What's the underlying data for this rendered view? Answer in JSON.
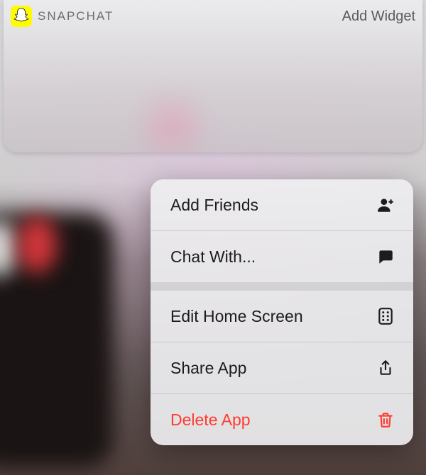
{
  "widget": {
    "app_name": "SNAPCHAT",
    "add_widget_label": "Add Widget",
    "icon_name": "snapchat-ghost-icon"
  },
  "context_menu": {
    "items": [
      {
        "label": "Add Friends",
        "icon": "add-friend-icon",
        "danger": false
      },
      {
        "label": "Chat With...",
        "icon": "chat-icon",
        "danger": false
      },
      {
        "label": "Edit Home Screen",
        "icon": "apps-grid-icon",
        "danger": false
      },
      {
        "label": "Share App",
        "icon": "share-icon",
        "danger": false
      },
      {
        "label": "Delete App",
        "icon": "trash-icon",
        "danger": true
      }
    ]
  },
  "colors": {
    "danger": "#ff3b30",
    "snap_yellow": "#fffc00"
  }
}
